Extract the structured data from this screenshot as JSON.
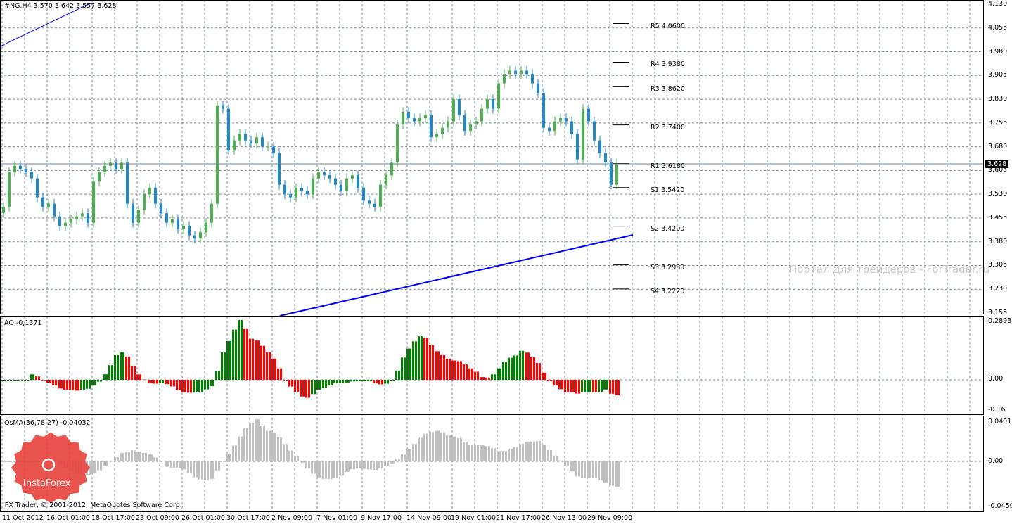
{
  "header": {
    "symbol_info": "#NG,H4  3.570 3.642 3.557 3.628"
  },
  "price_axis": [
    "4.130",
    "4.055",
    "3.980",
    "3.905",
    "3.830",
    "3.755",
    "3.680",
    "3.605",
    "3.530",
    "3.455",
    "3.380",
    "3.305",
    "3.230",
    "3.155"
  ],
  "current_price": "3.628",
  "pivots": [
    {
      "label": "R5 4.0600",
      "value": 4.06
    },
    {
      "label": "R4 3.9380",
      "value": 3.938
    },
    {
      "label": "R3 3.8620",
      "value": 3.862
    },
    {
      "label": "R2 3.7400",
      "value": 3.74
    },
    {
      "label": "R1 3.6180",
      "value": 3.618
    },
    {
      "label": "S1 3.5420",
      "value": 3.542
    },
    {
      "label": "S2 3.4200",
      "value": 3.42
    },
    {
      "label": "S3 3.2980",
      "value": 3.298
    },
    {
      "label": "S4 3.2220",
      "value": 3.222
    }
  ],
  "ao": {
    "label": "AO -0,1371",
    "max": "0.2893",
    "zero": "0.00",
    "min": "-0.16"
  },
  "osma": {
    "label": "OsMA(36,78,27) -0.04032",
    "max": "0.04016",
    "zero": "0.00",
    "min": "-0.04505"
  },
  "time_axis": [
    "11 Oct 2012",
    "16 Oct 01:00",
    "18 Oct 17:00",
    "23 Oct 09:00",
    "26 Oct 01:00",
    "30 Oct 17:00",
    "2 Nov 09:00",
    "7 Nov 01:00",
    "9 Nov 17:00",
    "14 Nov 09:00",
    "19 Nov 01:00",
    "21 Nov 17:00",
    "26 Nov 13:00",
    "29 Nov 09:00"
  ],
  "watermark": "Портал для трейдеров - ForTrader.ru",
  "copyright": "IFX Trader, © 2001-2012, MetaQuotes Software Corp.",
  "logo_text": "InstaForex",
  "colors": {
    "bull": "#4caf50",
    "bear": "#1e88c8",
    "ao_up": "#008000",
    "ao_down": "#ff0000",
    "osma": "#c0c0c0",
    "trend": "#0000ff"
  },
  "chart_data": {
    "type": "candlestick",
    "ylim": [
      3.155,
      4.13
    ],
    "closes": [
      3.49,
      3.6,
      3.62,
      3.61,
      3.6,
      3.58,
      3.52,
      3.49,
      3.5,
      3.46,
      3.43,
      3.44,
      3.45,
      3.46,
      3.47,
      3.44,
      3.57,
      3.6,
      3.62,
      3.63,
      3.61,
      3.63,
      3.5,
      3.44,
      3.48,
      3.53,
      3.55,
      3.5,
      3.47,
      3.44,
      3.45,
      3.42,
      3.43,
      3.4,
      3.39,
      3.41,
      3.44,
      3.5,
      3.81,
      3.8,
      3.67,
      3.7,
      3.72,
      3.7,
      3.69,
      3.71,
      3.68,
      3.68,
      3.66,
      3.56,
      3.53,
      3.52,
      3.55,
      3.54,
      3.53,
      3.58,
      3.6,
      3.59,
      3.58,
      3.56,
      3.54,
      3.58,
      3.59,
      3.55,
      3.51,
      3.5,
      3.49,
      3.56,
      3.59,
      3.63,
      3.75,
      3.79,
      3.77,
      3.76,
      3.77,
      3.78,
      3.71,
      3.72,
      3.74,
      3.76,
      3.83,
      3.78,
      3.73,
      3.75,
      3.76,
      3.8,
      3.83,
      3.8,
      3.88,
      3.91,
      3.92,
      3.91,
      3.92,
      3.91,
      3.88,
      3.85,
      3.74,
      3.73,
      3.76,
      3.77,
      3.76,
      3.72,
      3.64,
      3.8,
      3.76,
      3.7,
      3.66,
      3.63,
      3.56,
      3.628
    ]
  }
}
